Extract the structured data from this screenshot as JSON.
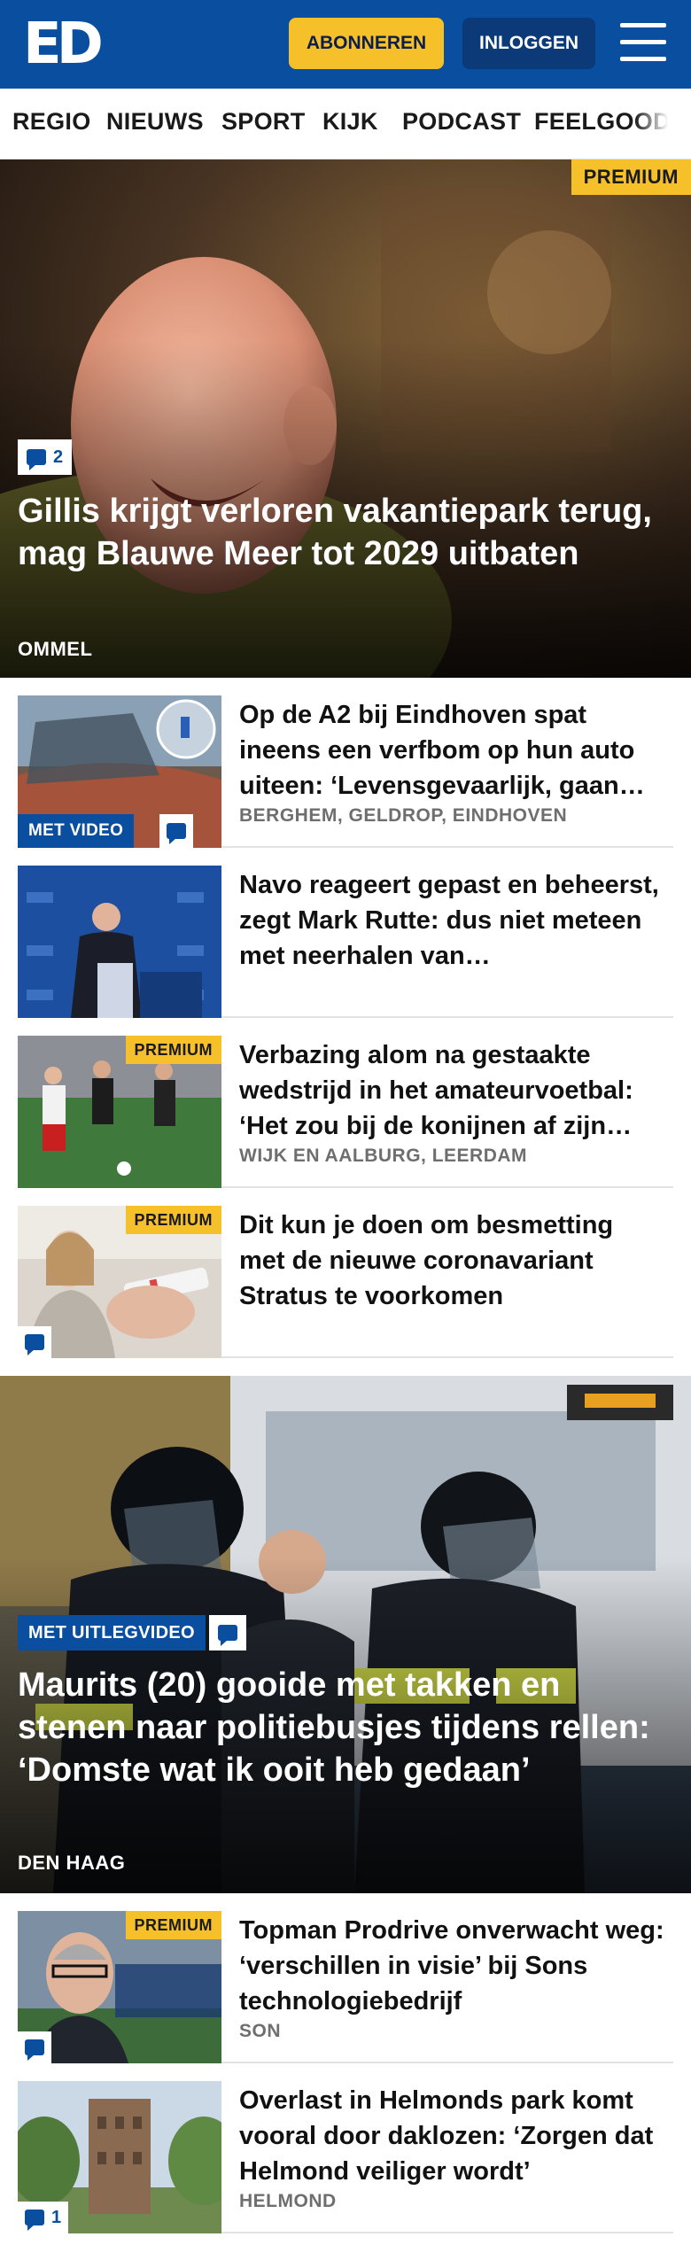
{
  "header": {
    "logo": "ED",
    "subscribe_label": "ABONNEREN",
    "login_label": "INLOGGEN",
    "colors": {
      "brand_blue": "#0a4ea0",
      "subscribe_yellow": "#f5c02a"
    }
  },
  "nav": {
    "items": [
      "REGIO",
      "NIEUWS",
      "SPORT",
      "KIJK",
      "PODCAST",
      "FEELGOOD"
    ]
  },
  "hero1": {
    "premium": "PREMIUM",
    "comments": "2",
    "title": "Gillis krijgt verloren vakantiepark terug, mag Blauwe Meer tot 2029 uitbaten",
    "place": "OMMEL"
  },
  "articles1": [
    {
      "title": "Op de A2 bij Eindhoven spat ineens een verfbom op hun auto uiteen: ‘Levensgevaarlijk, gaan…",
      "place": "BERGHEM, GELDROP, EINDHOVEN",
      "video": "MET VIDEO",
      "has_comments": true
    },
    {
      "title": "Navo reageert gepast en beheerst, zegt Mark Rutte: dus niet meteen met neerhalen van…",
      "place": ""
    },
    {
      "title": "Verbazing alom na gestaakte wedstrijd in het amateurvoetbal: ‘Het zou bij de konijnen af zijn als…",
      "place": "WIJK EN AALBURG, LEERDAM",
      "premium": "PREMIUM"
    },
    {
      "title": "Dit kun je doen om besmetting met de nieuwe coronavariant Stratus te voorkomen",
      "place": "",
      "premium": "PREMIUM",
      "has_comments": true
    }
  ],
  "hero2": {
    "video": "MET UITLEGVIDEO",
    "title": "Maurits (20) gooide met takken en stenen naar politiebusjes tijdens rellen: ‘Domste wat ik ooit heb gedaan’",
    "place": "DEN HAAG"
  },
  "articles2": [
    {
      "title": "Topman Prodrive onverwacht weg: ‘verschillen in visie’ bij Sons technologiebedrijf",
      "place": "SON",
      "premium": "PREMIUM",
      "has_comments": true
    },
    {
      "title": "Overlast in Helmonds park komt vooral door daklozen: ‘Zorgen dat Helmond veiliger wordt’",
      "place": "HELMOND",
      "comments": "1"
    }
  ]
}
